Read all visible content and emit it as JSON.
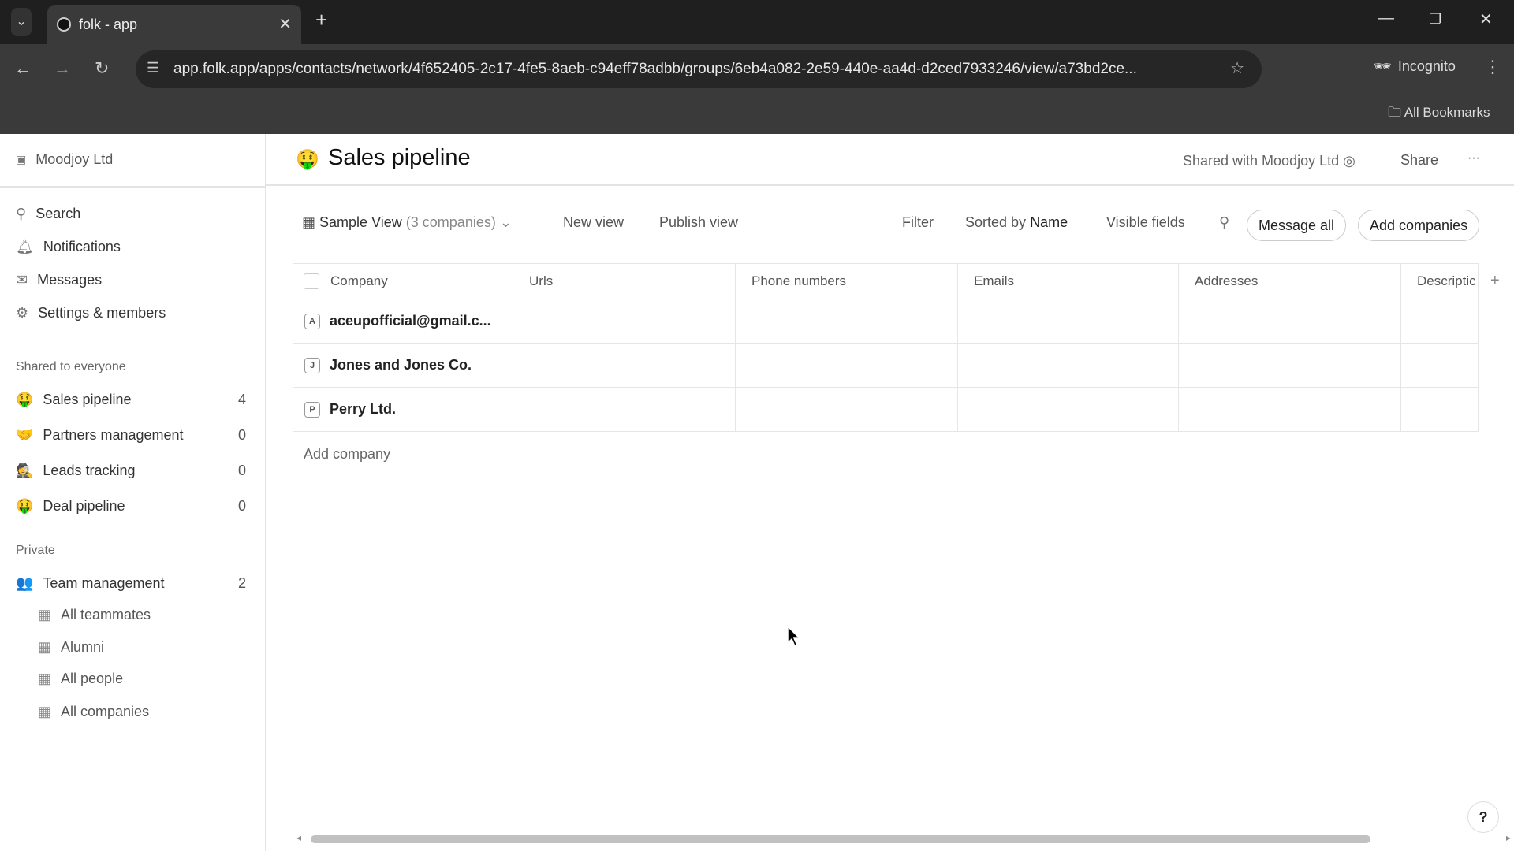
{
  "browser": {
    "tab_title": "folk - app",
    "url": "app.folk.app/apps/contacts/network/4f652405-2c17-4fe5-8aeb-c94eff78adbb/groups/6eb4a082-2e59-440e-aa4d-d2ced7933246/view/a73bd2ce...",
    "incognito_label": "Incognito",
    "bookmarks_label": "All Bookmarks"
  },
  "sidebar": {
    "workspace": "Moodjoy Ltd",
    "nav": [
      {
        "label": "Search"
      },
      {
        "label": "Notifications"
      },
      {
        "label": "Messages"
      },
      {
        "label": "Settings & members"
      }
    ],
    "shared_heading": "Shared to everyone",
    "shared": [
      {
        "emoji": "🤑",
        "label": "Sales pipeline",
        "count": "4"
      },
      {
        "emoji": "🤝",
        "label": "Partners management",
        "count": "0"
      },
      {
        "emoji": "🕵",
        "label": "Leads tracking",
        "count": "0"
      },
      {
        "emoji": "🤑",
        "label": "Deal pipeline",
        "count": "0"
      }
    ],
    "private_heading": "Private",
    "private": [
      {
        "emoji": "👥",
        "label": "Team management",
        "count": "2"
      }
    ],
    "views": [
      {
        "label": "All teammates"
      },
      {
        "label": "Alumni"
      },
      {
        "label": "All people"
      },
      {
        "label": "All companies"
      }
    ]
  },
  "header": {
    "emoji": "🤑",
    "title": "Sales pipeline",
    "shared_with": "Shared with Moodjoy Ltd",
    "share": "Share",
    "more": "···"
  },
  "toolbar": {
    "view_name": "Sample View",
    "view_count": "(3 companies)",
    "new_view": "New view",
    "publish_view": "Publish view",
    "filter": "Filter",
    "sorted_by": "Sorted by",
    "sort_field": "Name",
    "visible_fields": "Visible fields",
    "message_all": "Message all",
    "add_companies": "Add companies"
  },
  "table": {
    "columns": [
      "Company",
      "Urls",
      "Phone numbers",
      "Emails",
      "Addresses",
      "Descriptic"
    ],
    "rows": [
      {
        "letter": "A",
        "name": "aceupofficial@gmail.c..."
      },
      {
        "letter": "J",
        "name": "Jones and Jones Co."
      },
      {
        "letter": "P",
        "name": "Perry Ltd."
      }
    ],
    "add_row": "Add company"
  },
  "help": "?"
}
